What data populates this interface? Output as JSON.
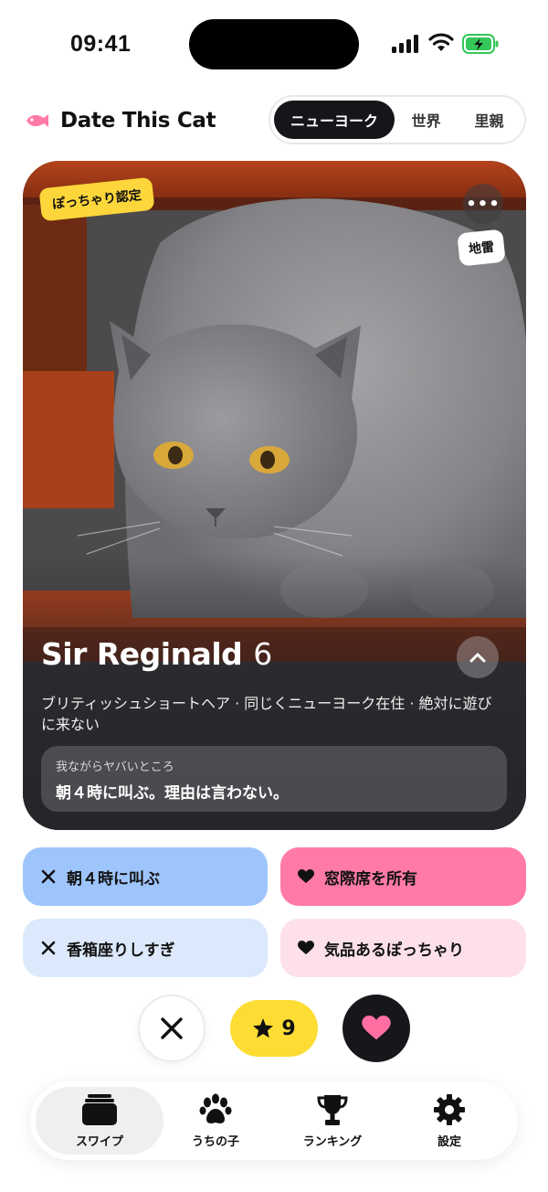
{
  "status_bar": {
    "time": "09:41"
  },
  "header": {
    "title": "Date This Cat",
    "segments": [
      "ニューヨーク",
      "世界",
      "里親"
    ],
    "active_segment": "ニューヨーク"
  },
  "card": {
    "badge_top_left": "ぽっちゃり認定",
    "badge_top_right": "地雷",
    "name": "Sir Reginald",
    "age": "6",
    "description": "ブリティッシュショートヘア · 同じくニューヨーク在住 · 絶対に遊びに来ない",
    "quirk_label": "我ながらヤバいところ",
    "quirk_text": "朝４時に叫ぶ。理由は言わない。"
  },
  "tags": [
    {
      "label": "朝４時に叫ぶ",
      "icon": "x-icon",
      "color": "#9ec5fb"
    },
    {
      "label": "窓際席を所有",
      "icon": "heart-icon",
      "color": "#ff7aa8"
    },
    {
      "label": "香箱座りしすぎ",
      "icon": "x-icon",
      "color": "#dce9fc"
    },
    {
      "label": "気品あるぽっちゃり",
      "icon": "heart-icon",
      "color": "#fde0ea"
    }
  ],
  "actions": {
    "super_like_count": "9"
  },
  "tabbar": [
    {
      "label": "スワイプ",
      "icon": "cards-icon",
      "active": true
    },
    {
      "label": "うちの子",
      "icon": "paw-icon",
      "active": false
    },
    {
      "label": "ランキング",
      "icon": "trophy-icon",
      "active": false
    },
    {
      "label": "設定",
      "icon": "gear-icon",
      "active": false
    }
  ]
}
